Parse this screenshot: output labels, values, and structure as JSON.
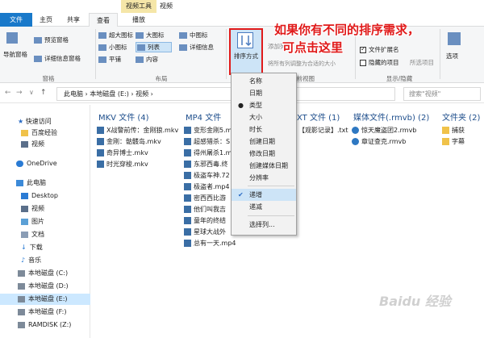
{
  "context_tabs": {
    "video_tools": "视频工具",
    "video": "视频"
  },
  "tabs": {
    "file": "文件",
    "home": "主页",
    "share": "共享",
    "view": "查看",
    "play": "播放"
  },
  "ribbon": {
    "nav_pane": "导航窗格",
    "preview_pane": "预览窗格",
    "details_pane": "详细信息窗格",
    "group_panes": "窗格",
    "layout": [
      "超大图标",
      "大图标",
      "中图标",
      "小图标",
      "列表",
      "详细信息",
      "平铺",
      "内容"
    ],
    "group_layout": "布局",
    "sort_by": "排序方式",
    "add_columns": "添加列",
    "fit_columns": "将所有列调整为合适的大小",
    "group_current_view": "当前视图",
    "file_ext": "文件扩展名",
    "hidden_items": "隐藏的项目",
    "hide_selected": "所选项目",
    "group_show_hide": "显示/隐藏",
    "options": "选项"
  },
  "annotation": {
    "line1": "如果你有不同的排序需求，",
    "line2": "可点击这里"
  },
  "address": {
    "path": "此电脑  ›  本地磁盘 (E:)  ›  视频  ›",
    "search_placeholder": "搜索\"视频\""
  },
  "nav": {
    "quick_access": "快速访问",
    "baidu": "百度经验",
    "videos": "视频",
    "onedrive": "OneDrive",
    "this_pc": "此电脑",
    "desktop": "Desktop",
    "pc_videos": "视频",
    "pictures": "图片",
    "documents": "文档",
    "downloads": "下载",
    "music": "音乐",
    "drive_c": "本地磁盘 (C:)",
    "drive_d": "本地磁盘 (D:)",
    "drive_e": "本地磁盘 (E:)",
    "drive_f": "本地磁盘 (F:)",
    "ramdisk": "RAMDISK (Z:)"
  },
  "groups": {
    "mkv": {
      "title": "MKV 文件 (4)",
      "files": [
        "X战警前传：金刚狼.mkv",
        "金刚：骷髅岛.mkv",
        "奇异博士.mkv",
        "时光穿梭.mkv"
      ]
    },
    "mp4": {
      "title": "MP4 文件",
      "files": [
        "变形金刚5.m",
        "超感猎杀：S",
        "得州屠杀1.m",
        "东邪西毒.终",
        "极盗车神.72",
        "极盗者.mp4",
        "密西西比游",
        "他们叫我吉",
        "童年的终结",
        "星球大战外",
        "总有一天.mp4"
      ]
    },
    "txt": {
      "title": "XT 文件 (1)",
      "files": [
        "【观影记录】.txt"
      ]
    },
    "rmvb": {
      "title": "媒体文件(.rmvb) (2)",
      "files": [
        "惊天魔盗团2.rmvb",
        "章证查克.rmvb"
      ]
    },
    "folder": {
      "title": "文件夹 (2)",
      "files": [
        "捕获",
        "字幕"
      ]
    }
  },
  "menu": {
    "items": [
      "名称",
      "日期",
      "类型",
      "大小",
      "时长",
      "创建日期",
      "修改日期",
      "创建媒体日期",
      "分辨率"
    ],
    "asc": "递增",
    "desc": "递减",
    "choose_cols": "选择列..."
  },
  "watermark": "Baidu 经验",
  "colors": {
    "accent": "#1979ca",
    "annotation": "#e01a1a",
    "highlight": "#cde4f7"
  }
}
